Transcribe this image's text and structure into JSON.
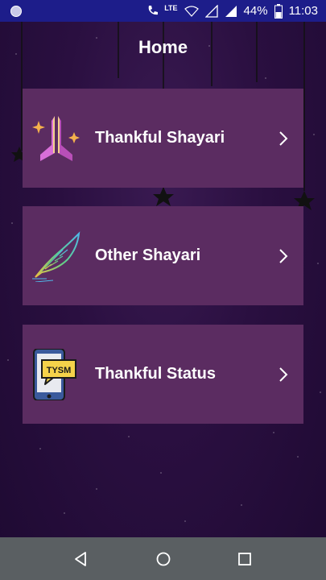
{
  "status_bar": {
    "network_lte": "LTE",
    "battery_percent": "44%",
    "time": "11:03"
  },
  "header": {
    "title": "Home"
  },
  "cards": [
    {
      "label": "Thankful Shayari",
      "icon": "praying-hands-icon"
    },
    {
      "label": "Other Shayari",
      "icon": "feather-icon"
    },
    {
      "label": "Thankful Status",
      "icon": "phone-tysm-icon",
      "icon_text": "TYSM"
    }
  ],
  "colors": {
    "status_bar": "#1d1d8a",
    "card_bg": "#5b2c61",
    "background": "#2a0f40",
    "nav_bar": "#5a5f62"
  },
  "nav": [
    "back-icon",
    "home-icon",
    "recents-icon"
  ]
}
